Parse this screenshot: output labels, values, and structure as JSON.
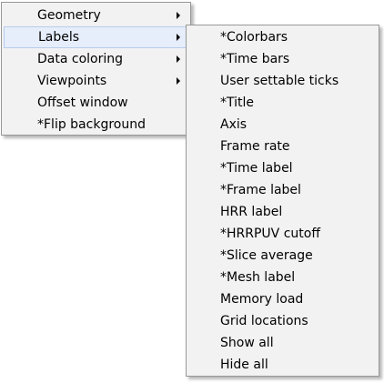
{
  "main_menu": {
    "items": [
      {
        "label": "Geometry",
        "has_submenu": true
      },
      {
        "label": "Labels",
        "has_submenu": true,
        "highlighted": true
      },
      {
        "label": "Data coloring",
        "has_submenu": true
      },
      {
        "label": "Viewpoints",
        "has_submenu": true
      },
      {
        "label": "Offset window",
        "has_submenu": false
      },
      {
        "label": "*Flip background",
        "has_submenu": false
      }
    ]
  },
  "labels_submenu": {
    "items": [
      {
        "label": "*Colorbars"
      },
      {
        "label": "*Time bars"
      },
      {
        "label": "User settable ticks"
      },
      {
        "label": "*Title"
      },
      {
        "label": "Axis"
      },
      {
        "label": "Frame rate"
      },
      {
        "label": "*Time label"
      },
      {
        "label": "*Frame label"
      },
      {
        "label": "HRR label"
      },
      {
        "label": "*HRRPUV cutoff"
      },
      {
        "label": "*Slice average"
      },
      {
        "label": "*Mesh label"
      },
      {
        "label": "Memory load"
      },
      {
        "label": "Grid locations"
      },
      {
        "label": "Show all"
      },
      {
        "label": "Hide all"
      }
    ]
  },
  "colors": {
    "menu_background": "#f2f2f2",
    "menu_border": "#979797",
    "highlight_background": "#e6eefb",
    "highlight_border": "#b6cdee"
  }
}
